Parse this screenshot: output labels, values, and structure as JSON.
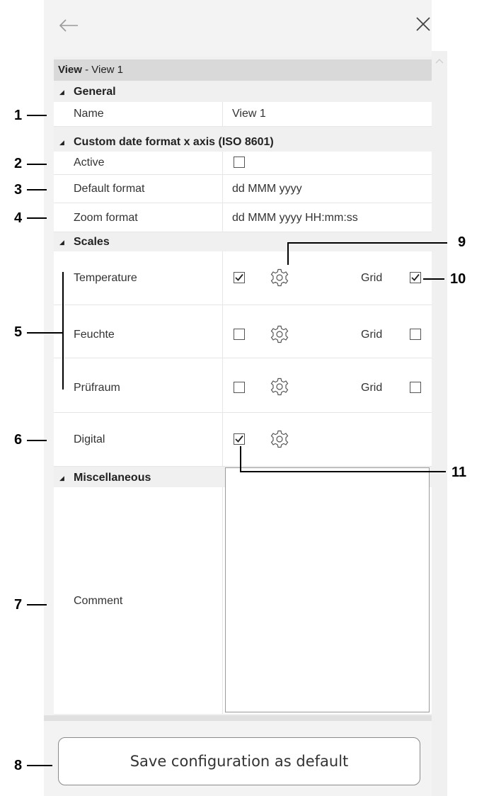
{
  "header": {
    "view_bold": "View",
    "view_rest": " - View 1"
  },
  "categories": {
    "general": "General",
    "custom_date": "Custom date format x axis (ISO 8601)",
    "scales": "Scales",
    "misc": "Miscellaneous"
  },
  "rows": {
    "name_label": "Name",
    "name_value": "View 1",
    "active_label": "Active",
    "default_format_label": "Default format",
    "default_format_value": "dd MMM yyyy",
    "zoom_format_label": "Zoom format",
    "zoom_format_value": "dd MMM yyyy HH:mm:ss"
  },
  "scales": [
    {
      "label": "Temperature",
      "checked": true,
      "grid_label": "Grid",
      "grid_checked": true
    },
    {
      "label": "Feuchte",
      "checked": false,
      "grid_label": "Grid",
      "grid_checked": false
    },
    {
      "label": "Prüfraum",
      "checked": false,
      "grid_label": "Grid",
      "grid_checked": false
    },
    {
      "label": "Digital",
      "checked": true
    }
  ],
  "misc": {
    "comment_label": "Comment",
    "comment_value": ""
  },
  "save_button": "Save configuration as default",
  "callouts": [
    "1",
    "2",
    "3",
    "4",
    "5",
    "6",
    "7",
    "8",
    "9",
    "10",
    "11"
  ]
}
